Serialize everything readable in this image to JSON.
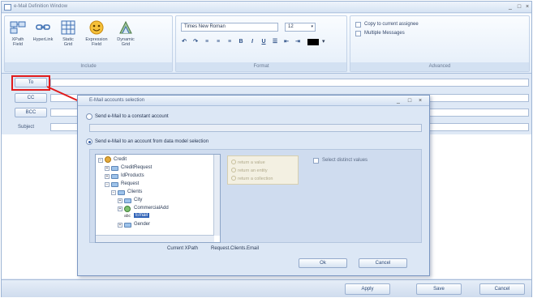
{
  "window": {
    "title": "e-Mail Definition Window",
    "controls": [
      "_",
      "□",
      "×"
    ]
  },
  "ribbon": {
    "include": {
      "caption": "Include",
      "buttons": [
        {
          "label": "XPath Field",
          "icon": "xpath-field-icon"
        },
        {
          "label": "HyperLink",
          "icon": "hyperlink-icon"
        },
        {
          "label": "Static Grid",
          "icon": "static-grid-icon"
        },
        {
          "label": "Expression Field",
          "icon": "expression-field-icon"
        },
        {
          "label": "Dynamic Grid",
          "icon": "dynamic-grid-icon"
        }
      ]
    },
    "format": {
      "caption": "Format",
      "font": "Times New Roman",
      "size": "12",
      "tools": [
        "↶",
        "↷",
        "≡",
        "≡",
        "≡",
        "B",
        "I",
        "U",
        "☰",
        "⇤",
        "⇥"
      ],
      "color": "#000000"
    },
    "advanced": {
      "caption": "Advanced",
      "options": [
        "Copy to current assignee",
        "Multiple Messages"
      ]
    }
  },
  "fields": {
    "to": "To",
    "cc": "CC",
    "bcc": "BCC",
    "subject": "Subject"
  },
  "dialog": {
    "title": "E-Mail accounts selection",
    "option_constant": "Send e-Mail to a constant account",
    "option_data_model": "Send e-Mail to an account from data model selection",
    "tree": [
      {
        "label": "Credit",
        "level": 0
      },
      {
        "label": "CreditRequest",
        "level": 1
      },
      {
        "label": "IdProducts",
        "level": 1
      },
      {
        "label": "Request",
        "level": 1
      },
      {
        "label": "Clients",
        "level": 2
      },
      {
        "label": "City",
        "level": 3
      },
      {
        "label": "CommercialAdd",
        "level": 3
      },
      {
        "label": "Email",
        "level": 3
      },
      {
        "label": "Gender",
        "level": 3
      }
    ],
    "return_options": [
      "return a value",
      "return an entity",
      "return a collection"
    ],
    "distinct_label": "Select distinct values",
    "xpath_label": "Current XPath",
    "xpath_value": "Request.Clients.Email",
    "ok": "Ok",
    "cancel": "Cancel"
  },
  "footer": {
    "apply": "Apply",
    "save": "Save",
    "cancel": "Cancel"
  },
  "colors": {
    "accent": "#2f62b7",
    "highlight": "#e11b1b",
    "chrome": "#dfe9f6"
  }
}
